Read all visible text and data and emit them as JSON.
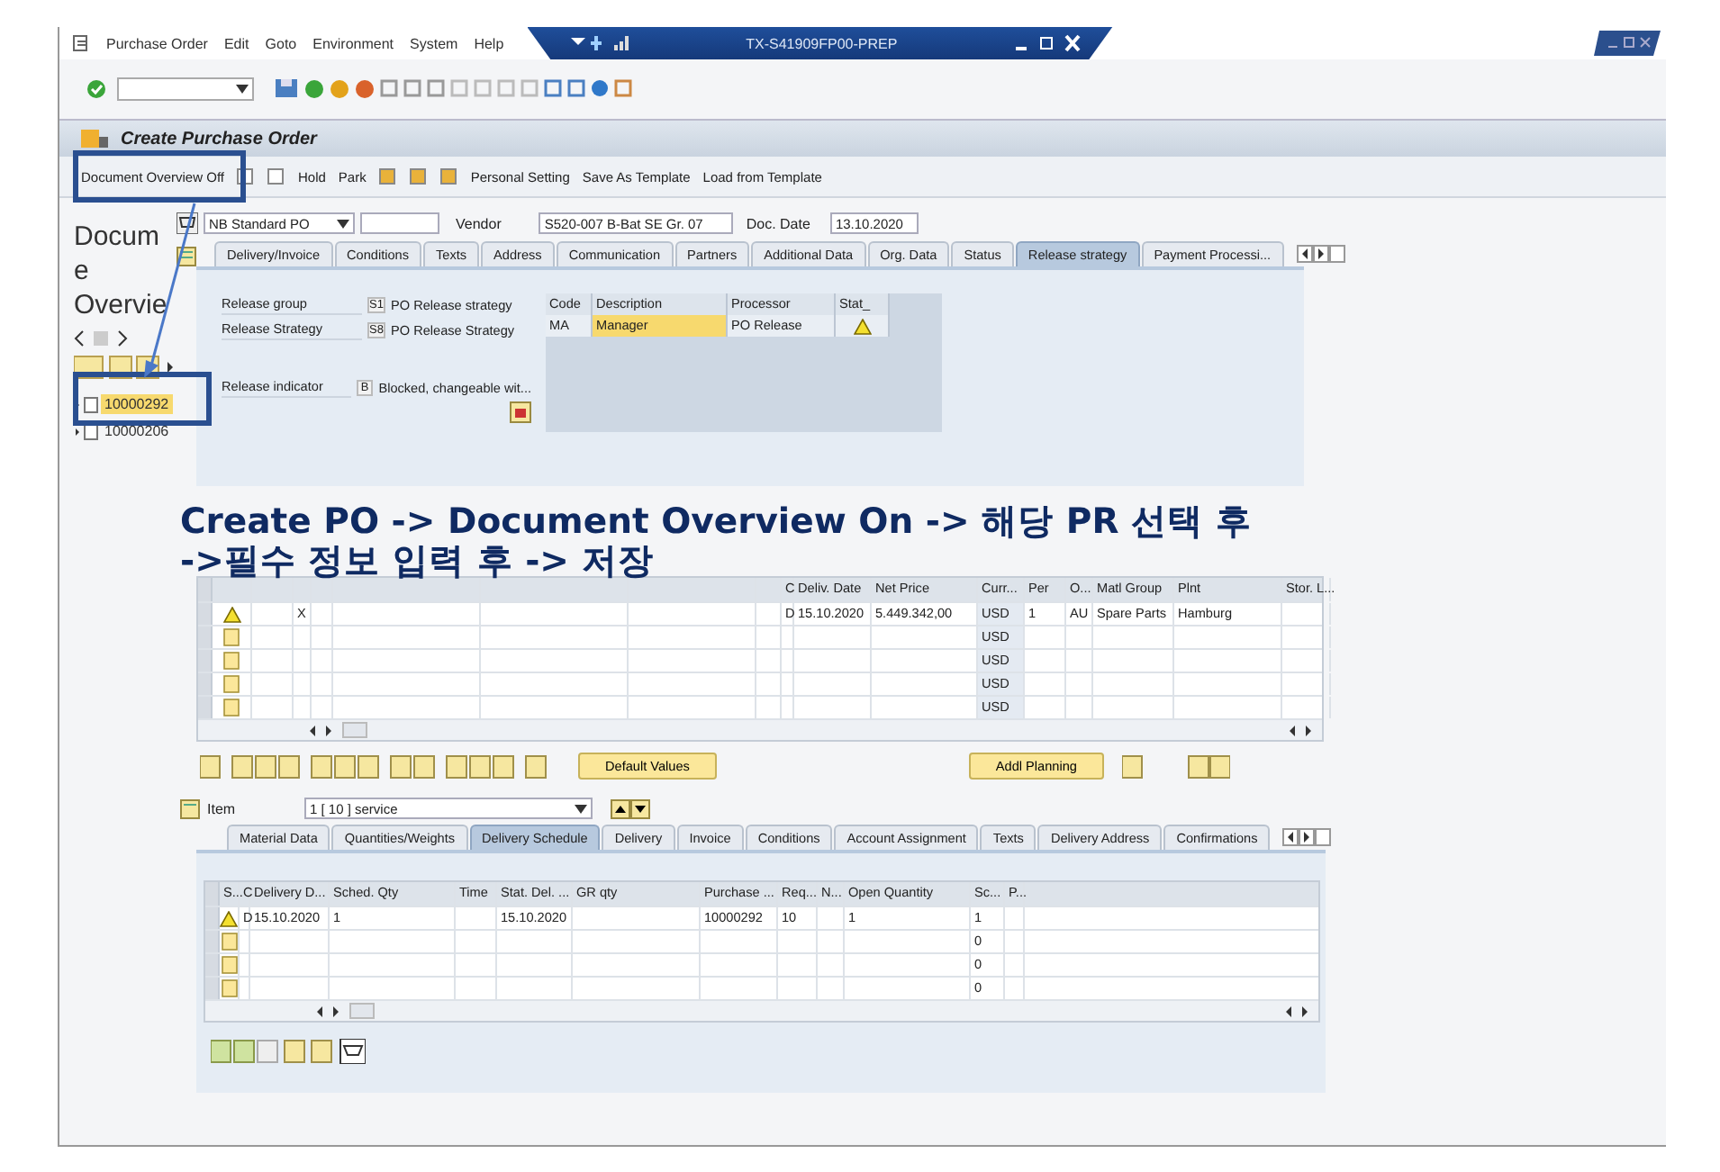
{
  "menu_bar": {
    "items": [
      "Purchase Order",
      "Edit",
      "Goto",
      "Environment",
      "System",
      "Help"
    ],
    "session": "TX-S41909FP00-PREP"
  },
  "title": "Create Purchase Order",
  "app_toolbar": [
    {
      "kind": "text",
      "label": "Document Overview Off"
    },
    {
      "kind": "icon"
    },
    {
      "kind": "icon"
    },
    {
      "kind": "text",
      "label": "Hold"
    },
    {
      "kind": "text",
      "label": "Park"
    },
    {
      "kind": "icon"
    },
    {
      "kind": "icon"
    },
    {
      "kind": "icon"
    },
    {
      "kind": "text",
      "label": "Personal Setting"
    },
    {
      "kind": "text",
      "label": "Save As Template"
    },
    {
      "kind": "text",
      "label": "Load from Template"
    }
  ],
  "doc_overview": {
    "title": "Docume Overvie",
    "items": [
      {
        "label": "10000292",
        "selected": true
      },
      {
        "label": "10000206",
        "selected": false
      }
    ]
  },
  "header": {
    "doc_type": "NB Standard PO",
    "vendor_label": "Vendor",
    "vendor": "S520-007 B-Bat SE Gr. 07",
    "doc_date_label": "Doc. Date",
    "doc_date": "13.10.2020"
  },
  "header_tabs": [
    {
      "label": "Delivery/Invoice",
      "selected": false
    },
    {
      "label": "Conditions",
      "selected": false
    },
    {
      "label": "Texts",
      "selected": false
    },
    {
      "label": "Address",
      "selected": false
    },
    {
      "label": "Communication",
      "selected": false
    },
    {
      "label": "Partners",
      "selected": false
    },
    {
      "label": "Additional Data",
      "selected": false
    },
    {
      "label": "Org. Data",
      "selected": false
    },
    {
      "label": "Status",
      "selected": false
    },
    {
      "label": "Release strategy",
      "selected": true
    },
    {
      "label": "Payment Processi...",
      "selected": false
    }
  ],
  "release": {
    "fields": [
      {
        "label": "Release group",
        "code": "S1",
        "text": "PO Release strategy"
      },
      {
        "label": "Release Strategy",
        "code": "S8",
        "text": "PO Release Strategy"
      },
      {
        "label": "Release indicator",
        "code": "B",
        "text": "Blocked, changeable wit..."
      }
    ],
    "columns": [
      "Code",
      "Description",
      "Processor",
      "Stat_"
    ],
    "rows": [
      {
        "code": "MA",
        "description": "Manager",
        "processor": "PO Release",
        "warning": true
      }
    ]
  },
  "items_table": {
    "columns": [
      "",
      "",
      "",
      "",
      "",
      "",
      "",
      "",
      "C",
      "Deliv. Date",
      "Net Price",
      "Curr...",
      "Per",
      "O...",
      "Matl Group",
      "Plnt",
      "Stor. L..."
    ],
    "rows": [
      {
        "warning": true,
        "cells": [
          "",
          "",
          "X",
          "",
          "",
          "",
          "",
          "",
          "D",
          "15.10.2020",
          "5.449.342,00",
          "USD",
          "1",
          "AU",
          "Spare Parts",
          "Hamburg",
          ""
        ]
      },
      {
        "warning": false,
        "cells": [
          "",
          "",
          "",
          "",
          "",
          "",
          "",
          "",
          "",
          "",
          "",
          "USD",
          "",
          "",
          "",
          "",
          ""
        ]
      },
      {
        "warning": false,
        "cells": [
          "",
          "",
          "",
          "",
          "",
          "",
          "",
          "",
          "",
          "",
          "",
          "USD",
          "",
          "",
          "",
          "",
          ""
        ]
      },
      {
        "warning": false,
        "cells": [
          "",
          "",
          "",
          "",
          "",
          "",
          "",
          "",
          "",
          "",
          "",
          "USD",
          "",
          "",
          "",
          "",
          ""
        ]
      },
      {
        "warning": false,
        "cells": [
          "",
          "",
          "",
          "",
          "",
          "",
          "",
          "",
          "",
          "",
          "",
          "USD",
          "",
          "",
          "",
          "",
          ""
        ]
      }
    ]
  },
  "item_buttons": [
    "Default Values",
    "Addl Planning"
  ],
  "item_detail": {
    "label": "Item",
    "value": "1 [ 10 ] service"
  },
  "item_tabs": [
    {
      "label": "Material Data",
      "selected": false
    },
    {
      "label": "Quantities/Weights",
      "selected": false
    },
    {
      "label": "Delivery Schedule",
      "selected": true
    },
    {
      "label": "Delivery",
      "selected": false
    },
    {
      "label": "Invoice",
      "selected": false
    },
    {
      "label": "Conditions",
      "selected": false
    },
    {
      "label": "Account Assignment",
      "selected": false
    },
    {
      "label": "Texts",
      "selected": false
    },
    {
      "label": "Delivery Address",
      "selected": false
    },
    {
      "label": "Confirmations",
      "selected": false
    }
  ],
  "schedule_table": {
    "columns": [
      "S...",
      "C",
      "Delivery D...",
      "Sched. Qty",
      "Time",
      "Stat. Del. ...",
      "GR qty",
      "Purchase ...",
      "Req...",
      "N...",
      "Open Quantity",
      "Sc...",
      "P..."
    ],
    "rows": [
      {
        "warning": true,
        "cells": [
          "",
          "D",
          "15.10.2020",
          "1",
          "",
          "15.10.2020",
          "",
          "10000292",
          "10",
          "",
          "1",
          "1",
          ""
        ]
      },
      {
        "warning": false,
        "cells": [
          "",
          "",
          "",
          "",
          "",
          "",
          "",
          "",
          "",
          "",
          "",
          "0",
          ""
        ]
      },
      {
        "warning": false,
        "cells": [
          "",
          "",
          "",
          "",
          "",
          "",
          "",
          "",
          "",
          "",
          "",
          "0",
          ""
        ]
      },
      {
        "warning": false,
        "cells": [
          "",
          "",
          "",
          "",
          "",
          "",
          "",
          "",
          "",
          "",
          "",
          "0",
          ""
        ]
      }
    ]
  },
  "caption": [
    "Create PO -> Document Overview On -> 해당 PR 선택 후",
    "->필수 정보 입력 후 -> 저장"
  ]
}
